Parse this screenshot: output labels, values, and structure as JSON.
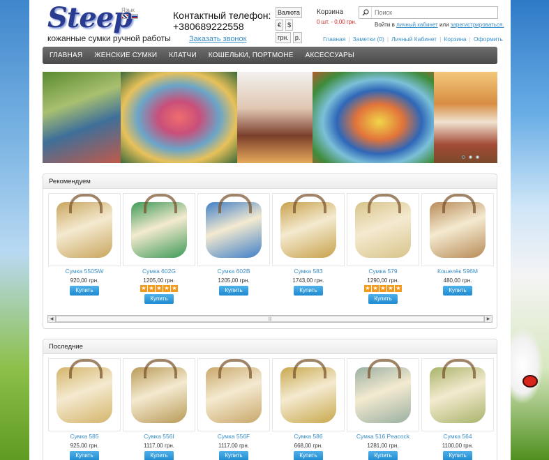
{
  "header": {
    "logo": "Steep",
    "language_label": "Язык",
    "tagline": "кожанные сумки ручной работы",
    "phone_label": "Контактный телефон:",
    "phone_number": "+380689222558",
    "callback_link": "Заказать звонок",
    "currency": {
      "label": "Валюта",
      "options": [
        "€",
        "$",
        "грн.",
        "р."
      ]
    },
    "cart": {
      "title": "Корзина",
      "summary": "0 шт. - 0,00 грн."
    },
    "search": {
      "placeholder": "Поиск"
    },
    "login": {
      "text_before": "Войти в",
      "login_link": "личный кабинет",
      "text_mid": "или",
      "register_link": "зарегистрироваться."
    },
    "toplinks": [
      "Главная",
      "Заметки (0)",
      "Личный Кабинет",
      "Корзина",
      "Оформить"
    ]
  },
  "nav": {
    "items": [
      "ГЛАВНАЯ",
      "ЖЕНСКИЕ СУМКИ",
      "КЛАТЧИ",
      "КОШЕЛЬКИ, ПОРТМОНЕ",
      "АКСЕССУАРЫ"
    ]
  },
  "recommended": {
    "title": "Рекомендуем",
    "products": [
      {
        "name": "Сумка 550SW",
        "price": "920,00 грн.",
        "rating": 0,
        "buy": "Купить",
        "color": "#c9a55e"
      },
      {
        "name": "Сумка 602G",
        "price": "1205,00 грн.",
        "rating": 5,
        "buy": "Купить",
        "color": "#3d9a56"
      },
      {
        "name": "Сумка 602B",
        "price": "1205,00 грн.",
        "rating": 0,
        "buy": "Купить",
        "color": "#3f7fc8"
      },
      {
        "name": "Сумка 583",
        "price": "1743,00 грн.",
        "rating": 0,
        "buy": "Купить",
        "color": "#c8a14c"
      },
      {
        "name": "Сумка 579",
        "price": "1290,00 грн.",
        "rating": 5,
        "buy": "Купить",
        "color": "#d8c48a"
      },
      {
        "name": "Кошелёк 596M",
        "price": "480,00 грн.",
        "rating": 0,
        "buy": "Купить",
        "color": "#b88b58"
      }
    ]
  },
  "latest": {
    "title": "Последние",
    "products": [
      {
        "name": "Сумка 585",
        "price": "925,00 грн.",
        "buy": "Купить",
        "color": "#d4b46a"
      },
      {
        "name": "Сумка 556I",
        "price": "1117,00 грн.",
        "buy": "Купить",
        "color": "#b99a58"
      },
      {
        "name": "Сумка 556F",
        "price": "1117,00 грн.",
        "buy": "Купить",
        "color": "#c9a76a"
      },
      {
        "name": "Сумка 586",
        "price": "668,00 грн.",
        "buy": "Купить",
        "color": "#c8a84e"
      },
      {
        "name": "Сумка 516 Peacock",
        "price": "1281,00 грн.",
        "buy": "Купить",
        "color": "#9ab0a2"
      },
      {
        "name": "Сумка 564",
        "price": "1100,00 грн.",
        "buy": "Купить",
        "color": "#a8b46a"
      }
    ]
  },
  "colors": {
    "accent": "#3b8fc7",
    "price_red": "#d21f1f",
    "logo": "#2a3c8f",
    "star": "#f29a1e"
  }
}
